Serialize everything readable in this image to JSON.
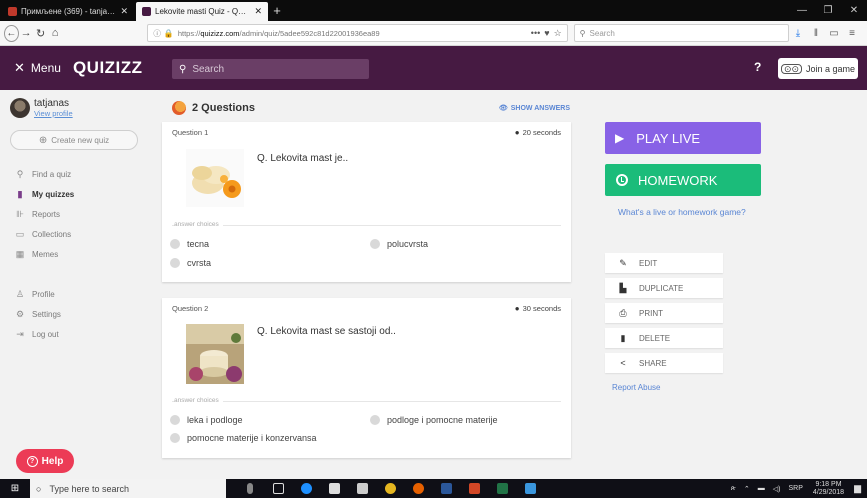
{
  "browser": {
    "tabs": [
      {
        "label": "Примљене (369) - tanja.serbia",
        "active": false,
        "favicon_color": "#c0392b"
      },
      {
        "label": "Lekovite masti Quiz - Quizizz",
        "active": true,
        "favicon_color": "#461a42"
      }
    ],
    "newtab": "+",
    "url_prefix": "https://",
    "url_domain": "quizizz.com",
    "url_path": "/admin/quiz/5adee592c81d22001936ea89",
    "url_more": "•••",
    "search_placeholder": "Search"
  },
  "app": {
    "menu_label": "Menu",
    "menu_icon": "close-icon",
    "logo": "QUIZIZZ",
    "search_placeholder": "Search",
    "help_mark": "?",
    "join_label": "Join a game"
  },
  "sidebar": {
    "user_name": "tatjanas",
    "view_profile": "View profile",
    "create_label": "Create new quiz",
    "nav": [
      {
        "label": "Find a quiz",
        "icon": "search-icon",
        "active": false
      },
      {
        "label": "My quizzes",
        "icon": "quizzes-icon",
        "active": true
      },
      {
        "label": "Reports",
        "icon": "reports-icon",
        "active": false
      },
      {
        "label": "Collections",
        "icon": "folder-icon",
        "active": false
      },
      {
        "label": "Memes",
        "icon": "memes-icon",
        "active": false
      }
    ],
    "bottom_nav": [
      {
        "label": "Profile",
        "icon": "profile-icon"
      },
      {
        "label": "Settings",
        "icon": "settings-icon"
      },
      {
        "label": "Log out",
        "icon": "logout-icon"
      }
    ],
    "help_label": "Help"
  },
  "main": {
    "questions_title": "2 Questions",
    "show_answers": "SHOW ANSWERS",
    "answer_choices_label": "answer choices",
    "questions": [
      {
        "number": "Question 1",
        "time": "20 seconds",
        "text": "Q. Lekovita mast je..",
        "choices": [
          "tecna",
          "polucvrsta",
          "cvrsta"
        ]
      },
      {
        "number": "Question 2",
        "time": "30 seconds",
        "text": "Q. Lekovita mast se sastoji od..",
        "choices": [
          "leka i podloge",
          "podloge i pomocne materije",
          "pomocne materije i konzervansa"
        ]
      }
    ]
  },
  "right": {
    "play_live": "PLAY LIVE",
    "homework": "HOMEWORK",
    "whats_live": "What's a live or homework game?",
    "actions": [
      {
        "label": "EDIT",
        "icon": "pencil-icon"
      },
      {
        "label": "DUPLICATE",
        "icon": "duplicate-icon"
      },
      {
        "label": "PRINT",
        "icon": "print-icon"
      },
      {
        "label": "DELETE",
        "icon": "trash-icon"
      },
      {
        "label": "SHARE",
        "icon": "share-icon"
      }
    ],
    "report_abuse": "Report Abuse",
    "colors": {
      "play_live": "#8862e6",
      "homework": "#1bbc7a",
      "header": "#461a42",
      "help": "#ec3b56"
    }
  },
  "taskbar": {
    "search_placeholder": "Type here to search",
    "tray_lang": "SRP",
    "time": "9:18 PM",
    "date": "4/29/2018"
  }
}
